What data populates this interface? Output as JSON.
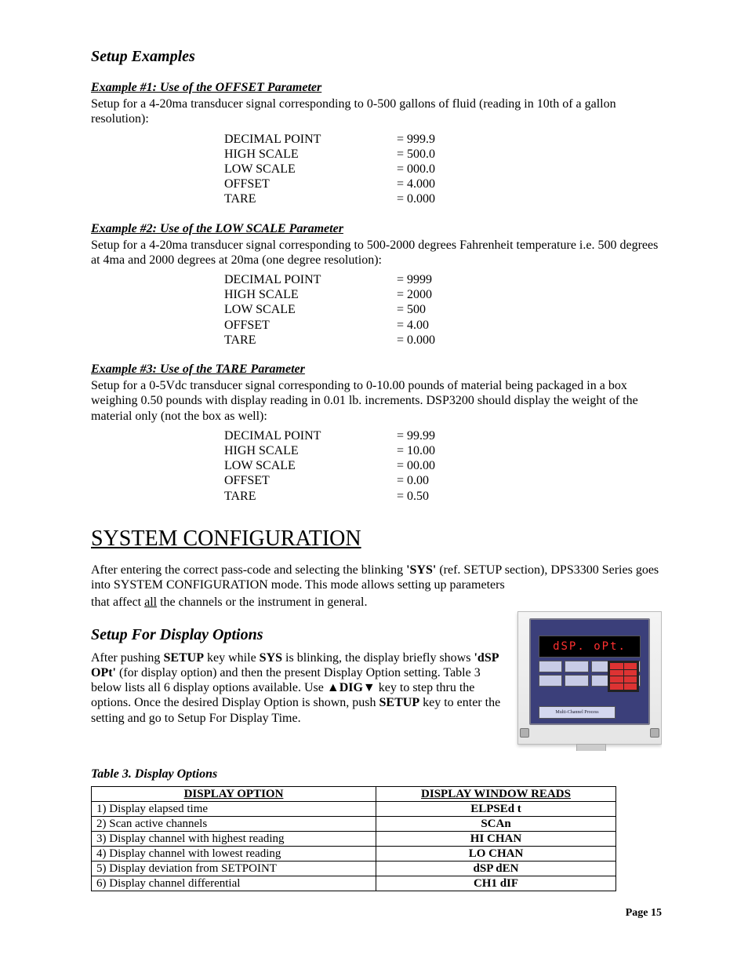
{
  "section_title": "Setup Examples",
  "ex1": {
    "heading": "Example #1: Use of the OFFSET Parameter",
    "desc": "Setup for a 4-20ma transducer signal corresponding to 0-500 gallons of fluid (reading in 10th of a gallon resolution):",
    "params": [
      {
        "name": "DECIMAL POINT",
        "val": "= 999.9"
      },
      {
        "name": "HIGH SCALE",
        "val": "= 500.0"
      },
      {
        "name": "LOW SCALE",
        "val": "= 000.0"
      },
      {
        "name": "OFFSET",
        "val": "= 4.000"
      },
      {
        "name": "TARE",
        "val": "= 0.000"
      }
    ]
  },
  "ex2": {
    "heading": "Example #2: Use of the LOW SCALE Parameter",
    "desc": "Setup for a 4-20ma transducer signal corresponding to 500-2000 degrees Fahrenheit temperature i.e. 500 degrees at 4ma and 2000 degrees at 20ma (one degree resolution):",
    "params": [
      {
        "name": "DECIMAL POINT",
        "val": "= 9999"
      },
      {
        "name": "HIGH SCALE",
        "val": "= 2000"
      },
      {
        "name": "LOW SCALE",
        "val": "= 500"
      },
      {
        "name": "OFFSET",
        "val": "= 4.00"
      },
      {
        "name": "TARE",
        "val": "= 0.000"
      }
    ]
  },
  "ex3": {
    "heading": "Example #3: Use of the TARE Parameter",
    "desc": "Setup for a 0-5Vdc transducer signal corresponding to 0-10.00 pounds of material being packaged in a box weighing 0.50 pounds with display reading in 0.01 lb. increments.  DSP3200 should display the weight of  the material only (not the box as well):",
    "params": [
      {
        "name": "DECIMAL POINT",
        "val": "= 99.99"
      },
      {
        "name": "HIGH SCALE",
        "val": "= 10.00"
      },
      {
        "name": "LOW SCALE",
        "val": "= 00.00"
      },
      {
        "name": "OFFSET",
        "val": "= 0.00"
      },
      {
        "name": "TARE",
        "val": "= 0.50"
      }
    ]
  },
  "sysconf": {
    "heading": "SYSTEM CONFIGURATION",
    "p1_a": "After entering the correct pass-code and selecting the blinking ",
    "p1_sys": "'SYS'",
    "p1_b": " (ref. SETUP section), DPS3300 Series goes into SYSTEM CONFIGURATION mode.  This mode allows setting up parameters",
    "p2_a": "that affect ",
    "p2_u": "all",
    "p2_b": " the channels or the instrument in general."
  },
  "dispopts": {
    "heading": "Setup For Display Options",
    "p_a": "After pushing ",
    "p_setup": "SETUP",
    "p_b": " key while ",
    "p_sys": "SYS",
    "p_c": " is blinking, the display briefly shows ",
    "p_dspopt": "'dSP  OPt'",
    "p_d": "  (for display option) and then the present Display Option setting.  Table 3 below lists all 6 display options available.  Use ",
    "p_tri1": "▲",
    "p_dig": "DIG",
    "p_tri2": "▼",
    "p_e": " key to step thru the options. Once the desired Display Option is shown, push ",
    "p_setup2": "SETUP",
    "p_f": " key to enter the setting and go to Setup For Display Time."
  },
  "device_screen": "dSP. oPt.",
  "table": {
    "caption": "Table 3.  Display Options",
    "h1": "DISPLAY OPTION",
    "h2": "DISPLAY WINDOW READS",
    "rows": [
      {
        "opt": "1) Display elapsed time",
        "reads": "ELPSEd t"
      },
      {
        "opt": "2) Scan active channels",
        "reads": "SCAn"
      },
      {
        "opt": "3) Display channel with highest reading",
        "reads": "HI  CHAN"
      },
      {
        "opt": "4) Display channel with lowest reading",
        "reads": "LO  CHAN"
      },
      {
        "opt": "5) Display deviation from SETPOINT",
        "reads": "dSP  dEN"
      },
      {
        "opt": "6) Display channel differential",
        "reads": "CH1 dIF"
      }
    ]
  },
  "page_number": "Page 15"
}
